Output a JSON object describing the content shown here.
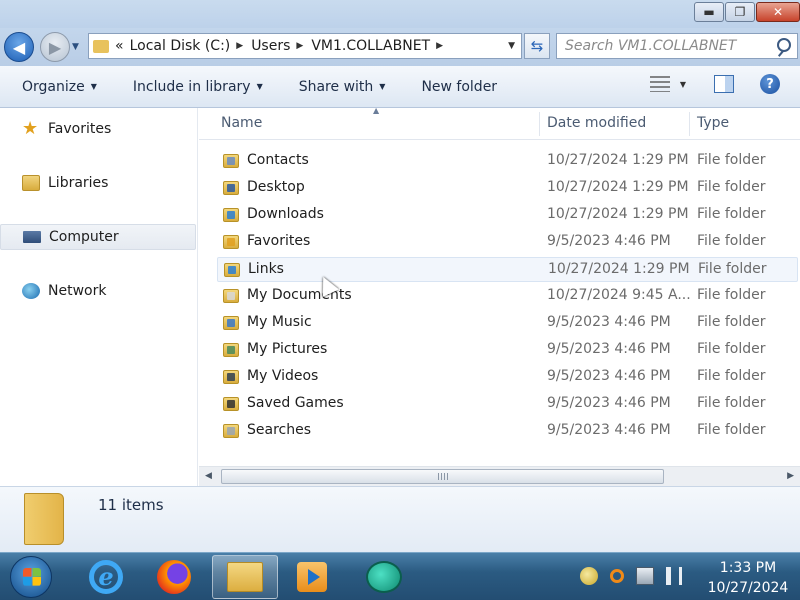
{
  "window": {
    "controls": {
      "minimize": "▬",
      "maximize": "❐",
      "close": "✕"
    }
  },
  "address": {
    "overflow": "«",
    "crumbs": [
      "Local Disk (C:)",
      "Users",
      "VM1.COLLABNET"
    ],
    "separator": "▶",
    "search_placeholder": "Search VM1.COLLABNET"
  },
  "toolbar": {
    "organize": "Organize",
    "include_in_library": "Include in library",
    "share_with": "Share with",
    "new_folder": "New folder",
    "help": "?"
  },
  "sidebar": {
    "items": [
      {
        "label": "Favorites",
        "icon": "star-icon"
      },
      {
        "label": "Libraries",
        "icon": "libraries-icon"
      },
      {
        "label": "Computer",
        "icon": "computer-icon"
      },
      {
        "label": "Network",
        "icon": "network-icon"
      }
    ]
  },
  "columns": {
    "name": "Name",
    "date": "Date modified",
    "type": "Type"
  },
  "files": [
    {
      "name": "Contacts",
      "date": "10/27/2024 1:29 PM",
      "type": "File folder",
      "badge": "#6a8cc2"
    },
    {
      "name": "Desktop",
      "date": "10/27/2024 1:29 PM",
      "type": "File folder",
      "badge": "#2c5aa0"
    },
    {
      "name": "Downloads",
      "date": "10/27/2024 1:29 PM",
      "type": "File folder",
      "badge": "#2a7fd4"
    },
    {
      "name": "Favorites",
      "date": "9/5/2023 4:46 PM",
      "type": "File folder",
      "badge": "#e0a020"
    },
    {
      "name": "Links",
      "date": "10/27/2024 1:29 PM",
      "type": "File folder",
      "badge": "#2a7fd4"
    },
    {
      "name": "My Documents",
      "date": "10/27/2024 9:45 A...",
      "type": "File folder",
      "badge": "#d8d8d8"
    },
    {
      "name": "My Music",
      "date": "9/5/2023 4:46 PM",
      "type": "File folder",
      "badge": "#3a78c8"
    },
    {
      "name": "My Pictures",
      "date": "9/5/2023 4:46 PM",
      "type": "File folder",
      "badge": "#4a8a5a"
    },
    {
      "name": "My Videos",
      "date": "9/5/2023 4:46 PM",
      "type": "File folder",
      "badge": "#304050"
    },
    {
      "name": "Saved Games",
      "date": "9/5/2023 4:46 PM",
      "type": "File folder",
      "badge": "#303030"
    },
    {
      "name": "Searches",
      "date": "9/5/2023 4:46 PM",
      "type": "File folder",
      "badge": "#9aa6b2"
    }
  ],
  "scrollbar": {
    "left": "◀",
    "right": "▶"
  },
  "details": {
    "count": "11 items"
  },
  "taskbar": {
    "apps": [
      "internet-explorer-icon",
      "firefox-icon",
      "file-explorer-icon",
      "media-player-icon",
      "chat-app-icon"
    ],
    "time": "1:33 PM",
    "date": "10/27/2024"
  }
}
